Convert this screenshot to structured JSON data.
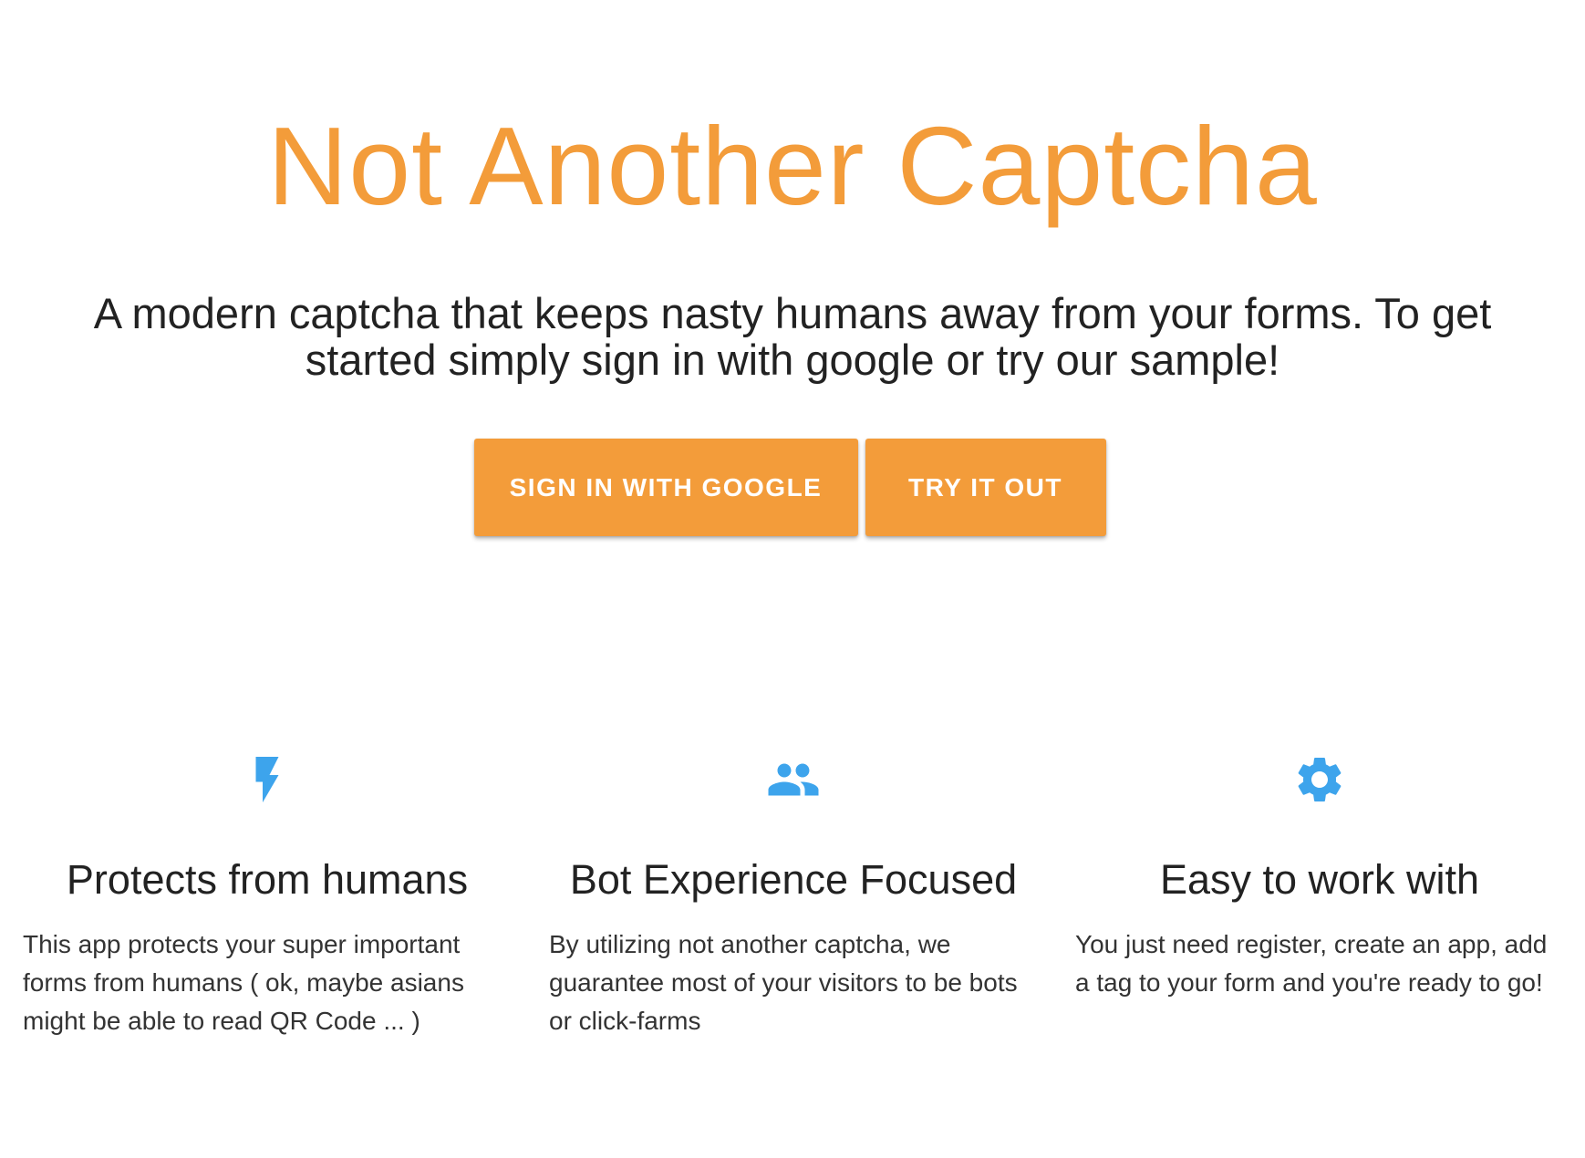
{
  "hero": {
    "title": "Not Another Captcha",
    "subtitle": "A modern captcha that keeps nasty humans away from your forms. To get started simply sign in with google or try our sample!",
    "buttons": {
      "sign_in_label": "SIGN IN WITH GOOGLE",
      "try_label": "TRY IT OUT"
    }
  },
  "features": [
    {
      "icon": "flash-icon",
      "title": "Protects from humans",
      "body": "This app protects your super important forms from humans ( ok, maybe asians might be able to read QR Code ... )"
    },
    {
      "icon": "people-icon",
      "title": "Bot Experience Focused",
      "body": "By utilizing not another captcha, we guarantee most of your visitors to be bots or click-farms"
    },
    {
      "icon": "gear-icon",
      "title": "Easy to work with",
      "body": "You just need register, create an app, add a tag to your form and you're ready to go!"
    }
  ],
  "colors": {
    "accent": "#f39c3a",
    "icon": "#3da4ec",
    "text": "#222222"
  }
}
